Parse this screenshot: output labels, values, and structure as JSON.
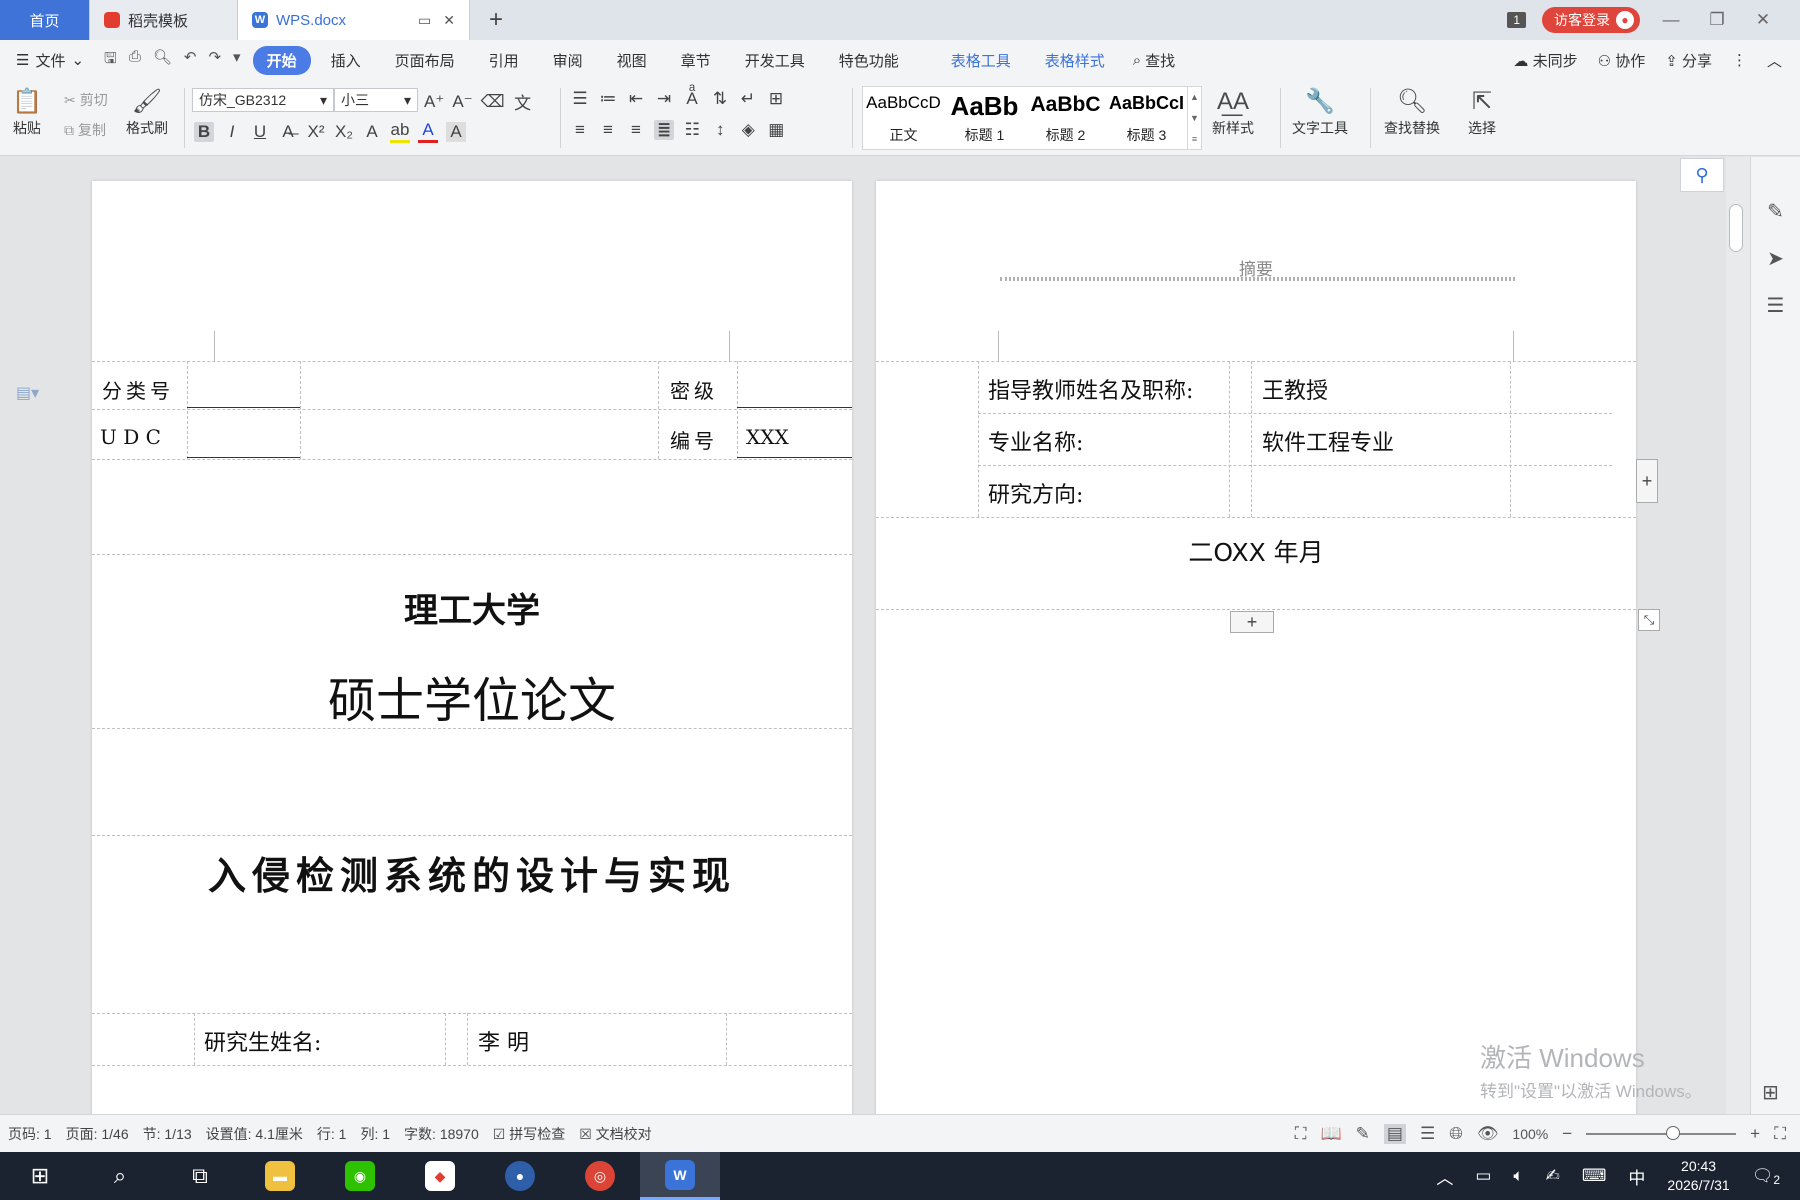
{
  "tabs": {
    "home": "首页",
    "daoke": "稻壳模板",
    "doc": "WPS.docx",
    "window_count": "1",
    "login": "访客登录"
  },
  "menu": {
    "file": "文件",
    "tabs": [
      "开始",
      "插入",
      "页面布局",
      "引用",
      "审阅",
      "视图",
      "章节",
      "开发工具",
      "特色功能"
    ],
    "table_tools": [
      "表格工具",
      "表格样式"
    ],
    "search": "查找",
    "sync": "未同步",
    "collab": "协作",
    "share": "分享"
  },
  "ribbon": {
    "paste": "粘贴",
    "cut": "剪切",
    "copy": "复制",
    "format_painter": "格式刷",
    "font_name": "仿宋_GB2312",
    "font_size": "小三",
    "styles": [
      {
        "sample": "AaBbCcD",
        "label": "正文"
      },
      {
        "sample": "AaBb",
        "label": "标题 1"
      },
      {
        "sample": "AaBbC",
        "label": "标题 2"
      },
      {
        "sample": "AaBbCcI",
        "label": "标题 3"
      }
    ],
    "new_style": "新样式",
    "text_tools": "文字工具",
    "find_replace": "查找替换",
    "select": "选择"
  },
  "page1": {
    "class_no_label": "分类号",
    "secret_label": "密级",
    "udc_label": "U D C",
    "serial_label": "编号",
    "serial_value": "XXX",
    "university": "理工大学",
    "degree": "硕士学位论文",
    "thesis_title": "入侵检测系统的设计与实现",
    "student_label": "研究生姓名:",
    "student_name": "李 明"
  },
  "page2": {
    "header": "摘要",
    "advisor_label": "指导教师姓名及职称:",
    "advisor_value": "王教授",
    "major_label": "专业名称:",
    "major_value": "软件工程专业",
    "direction_label": "研究方向:",
    "date": "二OXX 年月"
  },
  "watermark": {
    "line1": "激活 Windows",
    "line2": "转到\"设置\"以激活 Windows。"
  },
  "status": {
    "page": "页码: 1",
    "pages": "页面: 1/46",
    "section": "节: 1/13",
    "setting": "设置值: 4.1厘米",
    "row": "行: 1",
    "col": "列: 1",
    "words": "字数: 18970",
    "spell": "拼写检查",
    "proof": "文档校对",
    "zoom": "100%"
  },
  "taskbar": {
    "ime": "中",
    "time": "20:43",
    "date": "2026/7/31",
    "notify": "2"
  },
  "colors": {
    "accent": "#4b7be5",
    "home_tab": "#3f73d8",
    "login": "#e0453b",
    "taskbar": "#1b2330"
  }
}
